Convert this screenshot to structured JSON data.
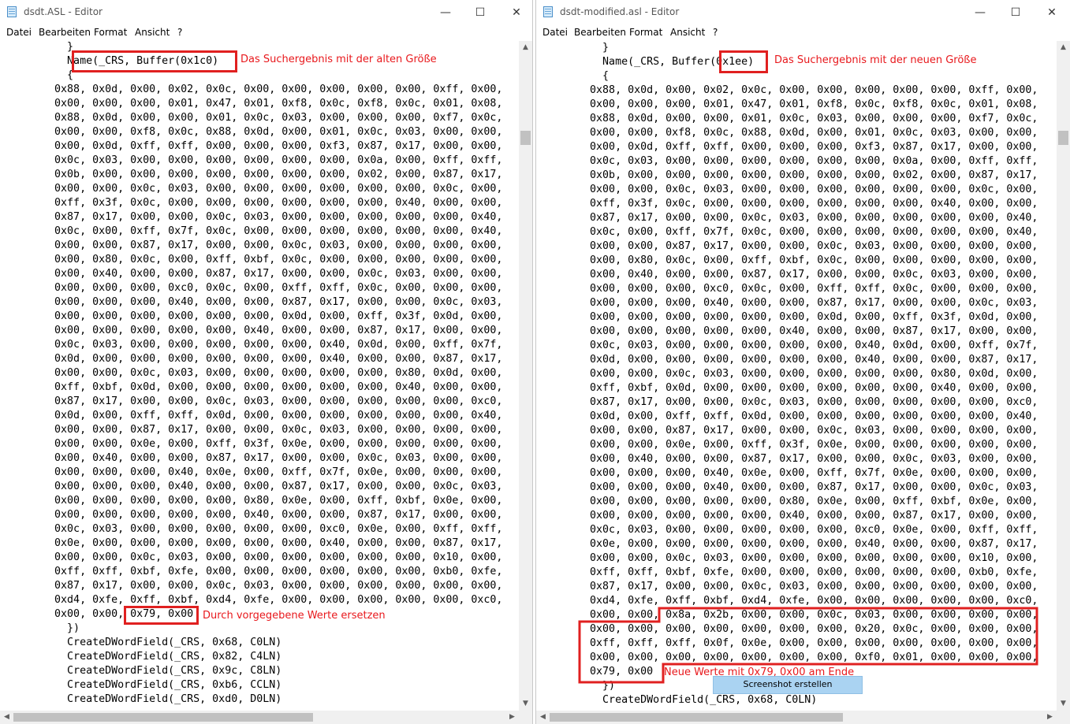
{
  "menu": [
    "Datei",
    "Bearbeiten",
    "Format",
    "Ansicht",
    "?"
  ],
  "window_controls": [
    "—",
    "☐",
    "✕"
  ],
  "colors": {
    "annotation": "#e8181c",
    "tooltip_bg": "#aad3f2"
  },
  "left": {
    "title": "dsdt.ASL - Editor",
    "code": "          }\n          Name(_CRS, Buffer(0x1c0)\n          {\n        0x88, 0x0d, 0x00, 0x02, 0x0c, 0x00, 0x00, 0x00, 0x00, 0x00, 0xff, 0x00,\n        0x00, 0x00, 0x00, 0x01, 0x47, 0x01, 0xf8, 0x0c, 0xf8, 0x0c, 0x01, 0x08,\n        0x88, 0x0d, 0x00, 0x00, 0x01, 0x0c, 0x03, 0x00, 0x00, 0x00, 0xf7, 0x0c,\n        0x00, 0x00, 0xf8, 0x0c, 0x88, 0x0d, 0x00, 0x01, 0x0c, 0x03, 0x00, 0x00,\n        0x00, 0x0d, 0xff, 0xff, 0x00, 0x00, 0x00, 0xf3, 0x87, 0x17, 0x00, 0x00,\n        0x0c, 0x03, 0x00, 0x00, 0x00, 0x00, 0x00, 0x00, 0x0a, 0x00, 0xff, 0xff,\n        0x0b, 0x00, 0x00, 0x00, 0x00, 0x00, 0x00, 0x00, 0x02, 0x00, 0x87, 0x17,\n        0x00, 0x00, 0x0c, 0x03, 0x00, 0x00, 0x00, 0x00, 0x00, 0x00, 0x0c, 0x00,\n        0xff, 0x3f, 0x0c, 0x00, 0x00, 0x00, 0x00, 0x00, 0x00, 0x40, 0x00, 0x00,\n        0x87, 0x17, 0x00, 0x00, 0x0c, 0x03, 0x00, 0x00, 0x00, 0x00, 0x00, 0x40,\n        0x0c, 0x00, 0xff, 0x7f, 0x0c, 0x00, 0x00, 0x00, 0x00, 0x00, 0x00, 0x40,\n        0x00, 0x00, 0x87, 0x17, 0x00, 0x00, 0x0c, 0x03, 0x00, 0x00, 0x00, 0x00,\n        0x00, 0x80, 0x0c, 0x00, 0xff, 0xbf, 0x0c, 0x00, 0x00, 0x00, 0x00, 0x00,\n        0x00, 0x40, 0x00, 0x00, 0x87, 0x17, 0x00, 0x00, 0x0c, 0x03, 0x00, 0x00,\n        0x00, 0x00, 0x00, 0xc0, 0x0c, 0x00, 0xff, 0xff, 0x0c, 0x00, 0x00, 0x00,\n        0x00, 0x00, 0x00, 0x40, 0x00, 0x00, 0x87, 0x17, 0x00, 0x00, 0x0c, 0x03,\n        0x00, 0x00, 0x00, 0x00, 0x00, 0x00, 0x0d, 0x00, 0xff, 0x3f, 0x0d, 0x00,\n        0x00, 0x00, 0x00, 0x00, 0x00, 0x40, 0x00, 0x00, 0x87, 0x17, 0x00, 0x00,\n        0x0c, 0x03, 0x00, 0x00, 0x00, 0x00, 0x00, 0x40, 0x0d, 0x00, 0xff, 0x7f,\n        0x0d, 0x00, 0x00, 0x00, 0x00, 0x00, 0x00, 0x40, 0x00, 0x00, 0x87, 0x17,\n        0x00, 0x00, 0x0c, 0x03, 0x00, 0x00, 0x00, 0x00, 0x00, 0x80, 0x0d, 0x00,\n        0xff, 0xbf, 0x0d, 0x00, 0x00, 0x00, 0x00, 0x00, 0x00, 0x40, 0x00, 0x00,\n        0x87, 0x17, 0x00, 0x00, 0x0c, 0x03, 0x00, 0x00, 0x00, 0x00, 0x00, 0xc0,\n        0x0d, 0x00, 0xff, 0xff, 0x0d, 0x00, 0x00, 0x00, 0x00, 0x00, 0x00, 0x40,\n        0x00, 0x00, 0x87, 0x17, 0x00, 0x00, 0x0c, 0x03, 0x00, 0x00, 0x00, 0x00,\n        0x00, 0x00, 0x0e, 0x00, 0xff, 0x3f, 0x0e, 0x00, 0x00, 0x00, 0x00, 0x00,\n        0x00, 0x40, 0x00, 0x00, 0x87, 0x17, 0x00, 0x00, 0x0c, 0x03, 0x00, 0x00,\n        0x00, 0x00, 0x00, 0x40, 0x0e, 0x00, 0xff, 0x7f, 0x0e, 0x00, 0x00, 0x00,\n        0x00, 0x00, 0x00, 0x40, 0x00, 0x00, 0x87, 0x17, 0x00, 0x00, 0x0c, 0x03,\n        0x00, 0x00, 0x00, 0x00, 0x00, 0x80, 0x0e, 0x00, 0xff, 0xbf, 0x0e, 0x00,\n        0x00, 0x00, 0x00, 0x00, 0x00, 0x40, 0x00, 0x00, 0x87, 0x17, 0x00, 0x00,\n        0x0c, 0x03, 0x00, 0x00, 0x00, 0x00, 0x00, 0xc0, 0x0e, 0x00, 0xff, 0xff,\n        0x0e, 0x00, 0x00, 0x00, 0x00, 0x00, 0x00, 0x40, 0x00, 0x00, 0x87, 0x17,\n        0x00, 0x00, 0x0c, 0x03, 0x00, 0x00, 0x00, 0x00, 0x00, 0x00, 0x10, 0x00,\n        0xff, 0xff, 0xbf, 0xfe, 0x00, 0x00, 0x00, 0x00, 0x00, 0x00, 0xb0, 0xfe,\n        0x87, 0x17, 0x00, 0x00, 0x0c, 0x03, 0x00, 0x00, 0x00, 0x00, 0x00, 0x00,\n        0xd4, 0xfe, 0xff, 0xbf, 0xd4, 0xfe, 0x00, 0x00, 0x00, 0x00, 0x00, 0xc0,\n        0x00, 0x00, 0x79, 0x00\n          })\n          CreateDWordField(_CRS, 0x68, C0LN)\n          CreateDWordField(_CRS, 0x82, C4LN)\n          CreateDWordField(_CRS, 0x9c, C8LN)\n          CreateDWordField(_CRS, 0xb6, CCLN)\n          CreateDWordField(_CRS, 0xd0, D0LN)",
    "annotations": {
      "old_size": "Das Suchergebnis mit der alten Größe",
      "replace": "Durch vorgegebene Werte ersetzen"
    }
  },
  "right": {
    "title": "dsdt-modified.asl - Editor",
    "code": "          }\n          Name(_CRS, Buffer(0x1ee)\n          {\n        0x88, 0x0d, 0x00, 0x02, 0x0c, 0x00, 0x00, 0x00, 0x00, 0x00, 0xff, 0x00,\n        0x00, 0x00, 0x00, 0x01, 0x47, 0x01, 0xf8, 0x0c, 0xf8, 0x0c, 0x01, 0x08,\n        0x88, 0x0d, 0x00, 0x00, 0x01, 0x0c, 0x03, 0x00, 0x00, 0x00, 0xf7, 0x0c,\n        0x00, 0x00, 0xf8, 0x0c, 0x88, 0x0d, 0x00, 0x01, 0x0c, 0x03, 0x00, 0x00,\n        0x00, 0x0d, 0xff, 0xff, 0x00, 0x00, 0x00, 0xf3, 0x87, 0x17, 0x00, 0x00,\n        0x0c, 0x03, 0x00, 0x00, 0x00, 0x00, 0x00, 0x00, 0x0a, 0x00, 0xff, 0xff,\n        0x0b, 0x00, 0x00, 0x00, 0x00, 0x00, 0x00, 0x00, 0x02, 0x00, 0x87, 0x17,\n        0x00, 0x00, 0x0c, 0x03, 0x00, 0x00, 0x00, 0x00, 0x00, 0x00, 0x0c, 0x00,\n        0xff, 0x3f, 0x0c, 0x00, 0x00, 0x00, 0x00, 0x00, 0x00, 0x40, 0x00, 0x00,\n        0x87, 0x17, 0x00, 0x00, 0x0c, 0x03, 0x00, 0x00, 0x00, 0x00, 0x00, 0x40,\n        0x0c, 0x00, 0xff, 0x7f, 0x0c, 0x00, 0x00, 0x00, 0x00, 0x00, 0x00, 0x40,\n        0x00, 0x00, 0x87, 0x17, 0x00, 0x00, 0x0c, 0x03, 0x00, 0x00, 0x00, 0x00,\n        0x00, 0x80, 0x0c, 0x00, 0xff, 0xbf, 0x0c, 0x00, 0x00, 0x00, 0x00, 0x00,\n        0x00, 0x40, 0x00, 0x00, 0x87, 0x17, 0x00, 0x00, 0x0c, 0x03, 0x00, 0x00,\n        0x00, 0x00, 0x00, 0xc0, 0x0c, 0x00, 0xff, 0xff, 0x0c, 0x00, 0x00, 0x00,\n        0x00, 0x00, 0x00, 0x40, 0x00, 0x00, 0x87, 0x17, 0x00, 0x00, 0x0c, 0x03,\n        0x00, 0x00, 0x00, 0x00, 0x00, 0x00, 0x0d, 0x00, 0xff, 0x3f, 0x0d, 0x00,\n        0x00, 0x00, 0x00, 0x00, 0x00, 0x40, 0x00, 0x00, 0x87, 0x17, 0x00, 0x00,\n        0x0c, 0x03, 0x00, 0x00, 0x00, 0x00, 0x00, 0x40, 0x0d, 0x00, 0xff, 0x7f,\n        0x0d, 0x00, 0x00, 0x00, 0x00, 0x00, 0x00, 0x40, 0x00, 0x00, 0x87, 0x17,\n        0x00, 0x00, 0x0c, 0x03, 0x00, 0x00, 0x00, 0x00, 0x00, 0x80, 0x0d, 0x00,\n        0xff, 0xbf, 0x0d, 0x00, 0x00, 0x00, 0x00, 0x00, 0x00, 0x40, 0x00, 0x00,\n        0x87, 0x17, 0x00, 0x00, 0x0c, 0x03, 0x00, 0x00, 0x00, 0x00, 0x00, 0xc0,\n        0x0d, 0x00, 0xff, 0xff, 0x0d, 0x00, 0x00, 0x00, 0x00, 0x00, 0x00, 0x40,\n        0x00, 0x00, 0x87, 0x17, 0x00, 0x00, 0x0c, 0x03, 0x00, 0x00, 0x00, 0x00,\n        0x00, 0x00, 0x0e, 0x00, 0xff, 0x3f, 0x0e, 0x00, 0x00, 0x00, 0x00, 0x00,\n        0x00, 0x40, 0x00, 0x00, 0x87, 0x17, 0x00, 0x00, 0x0c, 0x03, 0x00, 0x00,\n        0x00, 0x00, 0x00, 0x40, 0x0e, 0x00, 0xff, 0x7f, 0x0e, 0x00, 0x00, 0x00,\n        0x00, 0x00, 0x00, 0x40, 0x00, 0x00, 0x87, 0x17, 0x00, 0x00, 0x0c, 0x03,\n        0x00, 0x00, 0x00, 0x00, 0x00, 0x80, 0x0e, 0x00, 0xff, 0xbf, 0x0e, 0x00,\n        0x00, 0x00, 0x00, 0x00, 0x00, 0x40, 0x00, 0x00, 0x87, 0x17, 0x00, 0x00,\n        0x0c, 0x03, 0x00, 0x00, 0x00, 0x00, 0x00, 0xc0, 0x0e, 0x00, 0xff, 0xff,\n        0x0e, 0x00, 0x00, 0x00, 0x00, 0x00, 0x00, 0x40, 0x00, 0x00, 0x87, 0x17,\n        0x00, 0x00, 0x0c, 0x03, 0x00, 0x00, 0x00, 0x00, 0x00, 0x00, 0x10, 0x00,\n        0xff, 0xff, 0xbf, 0xfe, 0x00, 0x00, 0x00, 0x00, 0x00, 0x00, 0xb0, 0xfe,\n        0x87, 0x17, 0x00, 0x00, 0x0c, 0x03, 0x00, 0x00, 0x00, 0x00, 0x00, 0x00,\n        0xd4, 0xfe, 0xff, 0xbf, 0xd4, 0xfe, 0x00, 0x00, 0x00, 0x00, 0x00, 0xc0,\n        0x00, 0x00, 0x8a, 0x2b, 0x00, 0x00, 0x0c, 0x03, 0x00, 0x00, 0x00, 0x00,\n        0x00, 0x00, 0x00, 0x00, 0x00, 0x00, 0x00, 0x20, 0x0c, 0x00, 0x00, 0x00,\n        0xff, 0xff, 0xff, 0x0f, 0x0e, 0x00, 0x00, 0x00, 0x00, 0x00, 0x00, 0x00,\n        0x00, 0x00, 0x00, 0x00, 0x00, 0x00, 0x00, 0xf0, 0x01, 0x00, 0x00, 0x00,\n        0x79, 0x00\n          })\n          CreateDWordField(_CRS, 0x68, C0LN)",
    "annotations": {
      "new_size": "Das Suchergebnis mit der neuen Größe",
      "new_values": "Neue Werte mit 0x79, 0x00 am Ende"
    },
    "tooltip": "Screenshot erstellen"
  }
}
